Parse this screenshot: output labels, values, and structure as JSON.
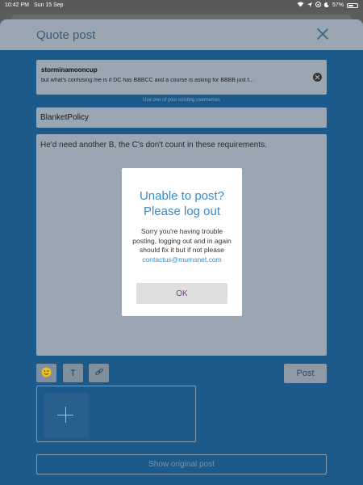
{
  "status_bar": {
    "time": "10:42 PM",
    "date": "Sun 15 Sep",
    "battery": "57%",
    "battery_level": 0.57
  },
  "modal": {
    "title": "Quote post",
    "quoted": {
      "username": "storminamooncup",
      "text": "but what's confusing me is if DC has BBBCC and a course is asking for BBBB just f..."
    },
    "hint": "Use one of your existing usernames",
    "username_value": "BlanketPolicy",
    "body_text": "He'd need another B, the C's don't count in these requirements.",
    "toolbar": {
      "text_format_label": "T",
      "post_label": "Post"
    },
    "show_original_label": "Show original post"
  },
  "alert": {
    "title": "Unable to post? Please log out",
    "message": "Sorry you're having trouble posting, logging out and in again should fix it but if not please",
    "link": "contactus@mumsnet.com",
    "ok_label": "OK"
  }
}
